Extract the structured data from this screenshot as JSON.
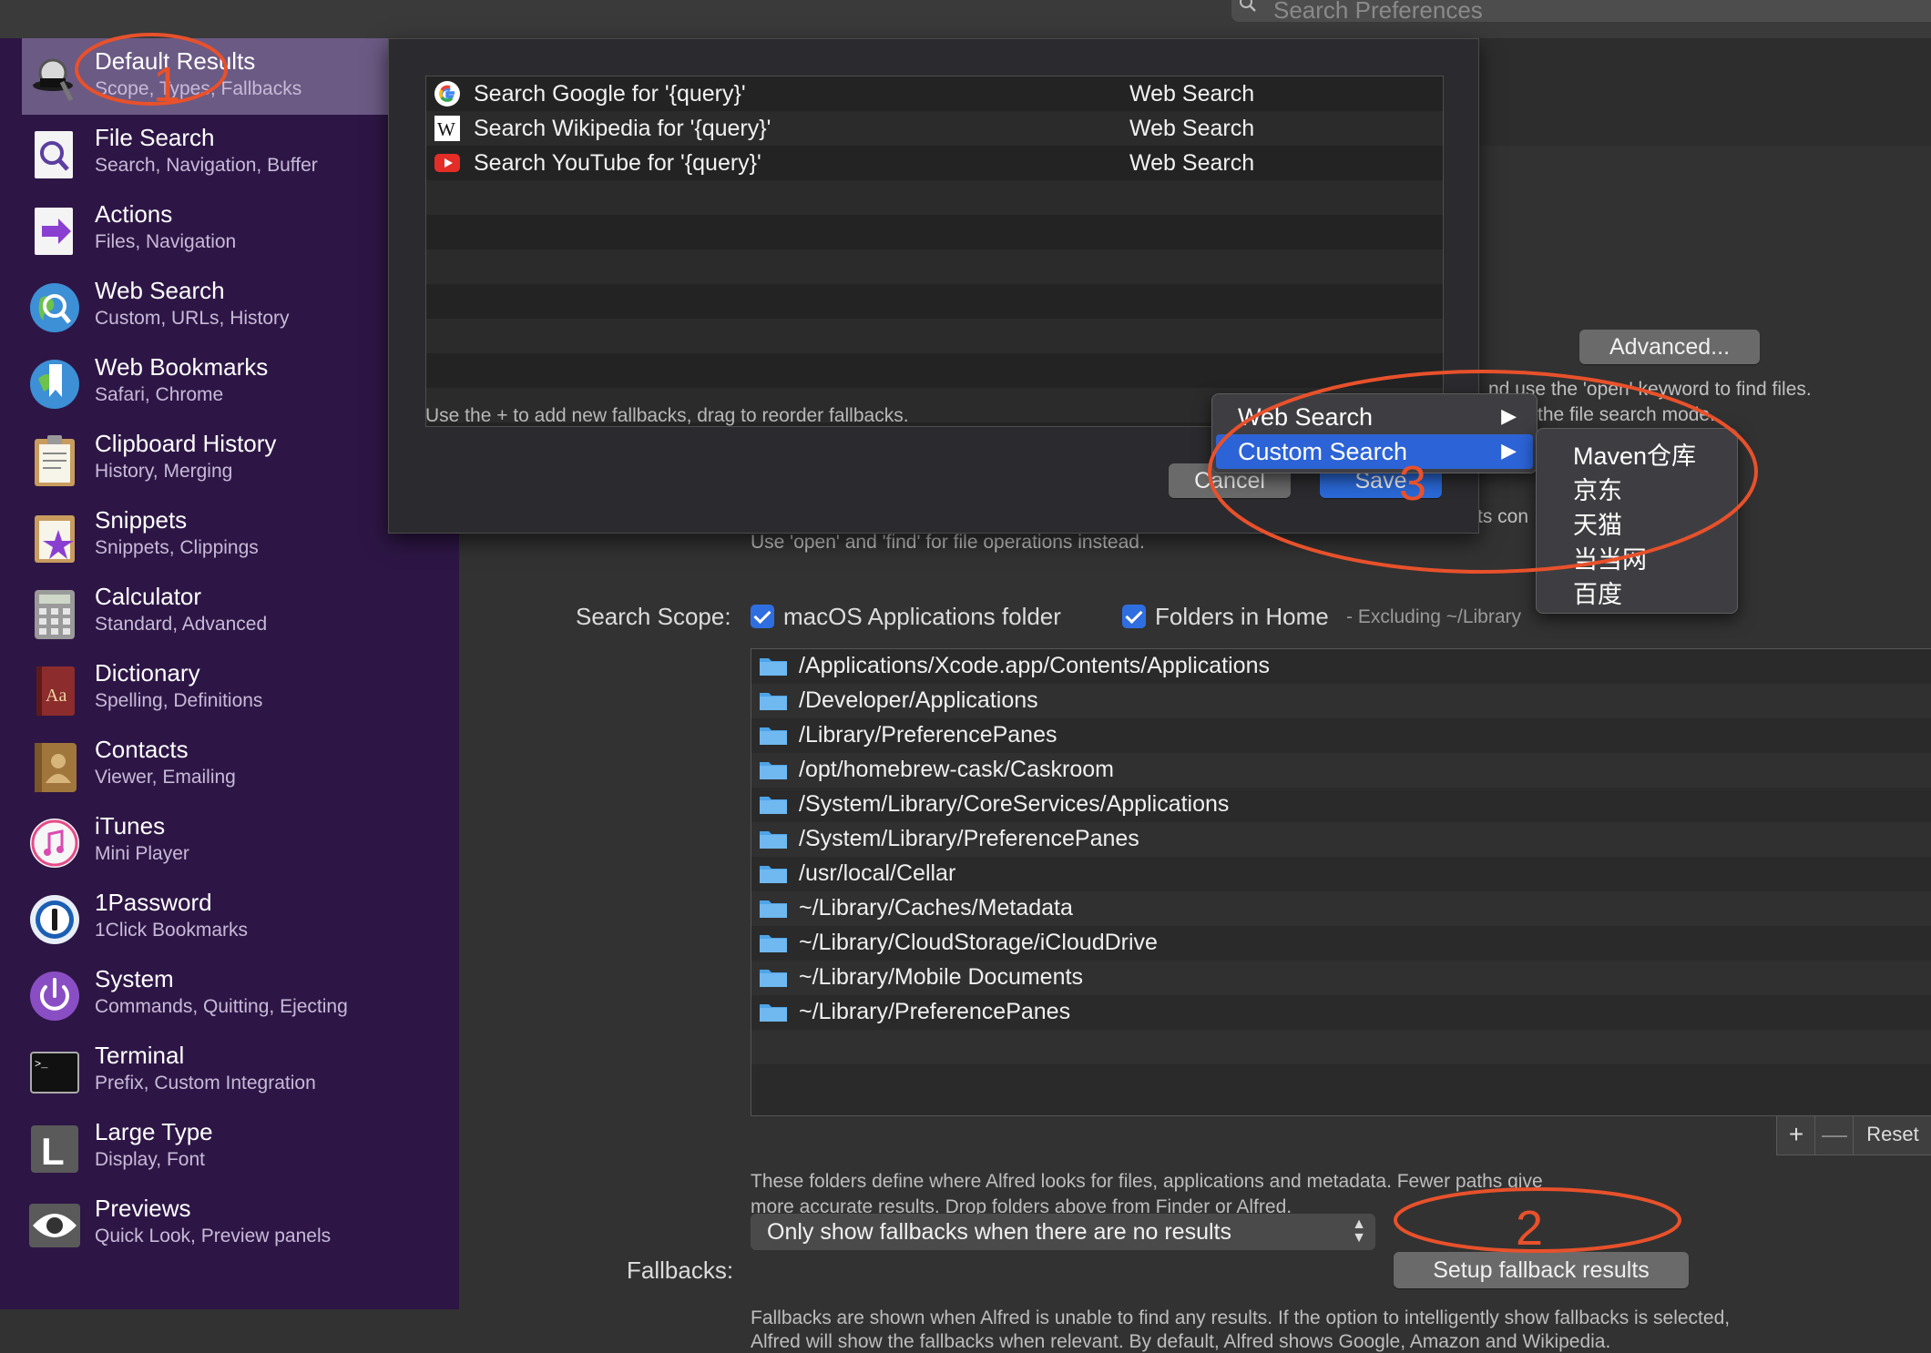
{
  "search": {
    "placeholder": "Search Preferences"
  },
  "sidebar": {
    "items": [
      {
        "title": "Default Results",
        "subtitle": "Scope, Types, Fallbacks",
        "icon": "alfred-hat-icon",
        "selected": true
      },
      {
        "title": "File Search",
        "subtitle": "Search, Navigation, Buffer",
        "icon": "file-search-icon"
      },
      {
        "title": "Actions",
        "subtitle": "Files, Navigation",
        "icon": "actions-icon"
      },
      {
        "title": "Web Search",
        "subtitle": "Custom, URLs, History",
        "icon": "globe-search-icon"
      },
      {
        "title": "Web Bookmarks",
        "subtitle": "Safari, Chrome",
        "icon": "bookmark-globe-icon"
      },
      {
        "title": "Clipboard History",
        "subtitle": "History, Merging",
        "icon": "clipboard-icon"
      },
      {
        "title": "Snippets",
        "subtitle": "Snippets, Clippings",
        "icon": "snippets-icon"
      },
      {
        "title": "Calculator",
        "subtitle": "Standard, Advanced",
        "icon": "calculator-icon"
      },
      {
        "title": "Dictionary",
        "subtitle": "Spelling, Definitions",
        "icon": "dictionary-icon"
      },
      {
        "title": "Contacts",
        "subtitle": "Viewer, Emailing",
        "icon": "contacts-icon"
      },
      {
        "title": "iTunes",
        "subtitle": "Mini Player",
        "icon": "itunes-icon"
      },
      {
        "title": "1Password",
        "subtitle": "1Click Bookmarks",
        "icon": "onepassword-icon"
      },
      {
        "title": "System",
        "subtitle": "Commands, Quitting, Ejecting",
        "icon": "power-icon"
      },
      {
        "title": "Terminal",
        "subtitle": "Prefix, Custom Integration",
        "icon": "terminal-icon"
      },
      {
        "title": "Large Type",
        "subtitle": "Display, Font",
        "icon": "large-type-icon"
      },
      {
        "title": "Previews",
        "subtitle": "Quick Look, Preview panels",
        "icon": "eye-icon"
      }
    ]
  },
  "main": {
    "advanced_button": "Advanced...",
    "partial_text_1": "nd use the 'open' keyword to find files.",
    "partial_text_2": "the file search mode.",
    "partial_text_3": "ts con",
    "open_find_hint": "Use 'open' and 'find' for file operations instead.",
    "search_scope_label": "Search Scope:",
    "scope_checkbox_1": "macOS Applications folder",
    "scope_checkbox_2": "Folders in Home",
    "scope_excluding": "- Excluding ~/Library",
    "folders": [
      "/Applications/Xcode.app/Contents/Applications",
      "/Developer/Applications",
      "/Library/PreferencePanes",
      "/opt/homebrew-cask/Caskroom",
      "/System/Library/CoreServices/Applications",
      "/System/Library/PreferencePanes",
      "/usr/local/Cellar",
      "~/Library/Caches/Metadata",
      "~/Library/CloudStorage/iCloudDrive",
      "~/Library/Mobile Documents",
      "~/Library/PreferencePanes"
    ],
    "folders_help_1": "These folders define where Alfred looks for files, applications and metadata. Fewer paths give",
    "folders_help_2": "more accurate results. Drop folders above from Finder or Alfred.",
    "plus": "+",
    "minus": "—",
    "reset": "Reset",
    "fallbacks_label": "Fallbacks:",
    "fallbacks_select": "Only show fallbacks when there are no results",
    "setup_fallback_button": "Setup fallback results",
    "fallbacks_help_1": "Fallbacks are shown when Alfred is unable to find any results. If the option to intelligently show fallbacks is selected,",
    "fallbacks_help_2": "Alfred will show the fallbacks when relevant. By default, Alfred shows Google, Amazon and Wikipedia."
  },
  "sheet": {
    "rows": [
      {
        "name": "Search Google for '{query}'",
        "type": "Web Search",
        "icon": "google-icon"
      },
      {
        "name": "Search Wikipedia for '{query}'",
        "type": "Web Search",
        "icon": "wikipedia-icon"
      },
      {
        "name": "Search YouTube for '{query}'",
        "type": "Web Search",
        "icon": "youtube-icon"
      }
    ],
    "hint": "Use the + to add new fallbacks, drag to reorder fallbacks.",
    "cancel": "Cancel",
    "save": "Save"
  },
  "menu": {
    "items": [
      {
        "label": "Web Search",
        "arrow": "▶"
      },
      {
        "label": "Custom Search",
        "arrow": "▶",
        "highlighted": true
      }
    ],
    "submenu": [
      "Maven仓库",
      "京东",
      "天猫",
      "当当网",
      "百度"
    ]
  },
  "annotations": {
    "n1": "1",
    "n2": "2",
    "n3": "3",
    "color": "#e8512b"
  }
}
